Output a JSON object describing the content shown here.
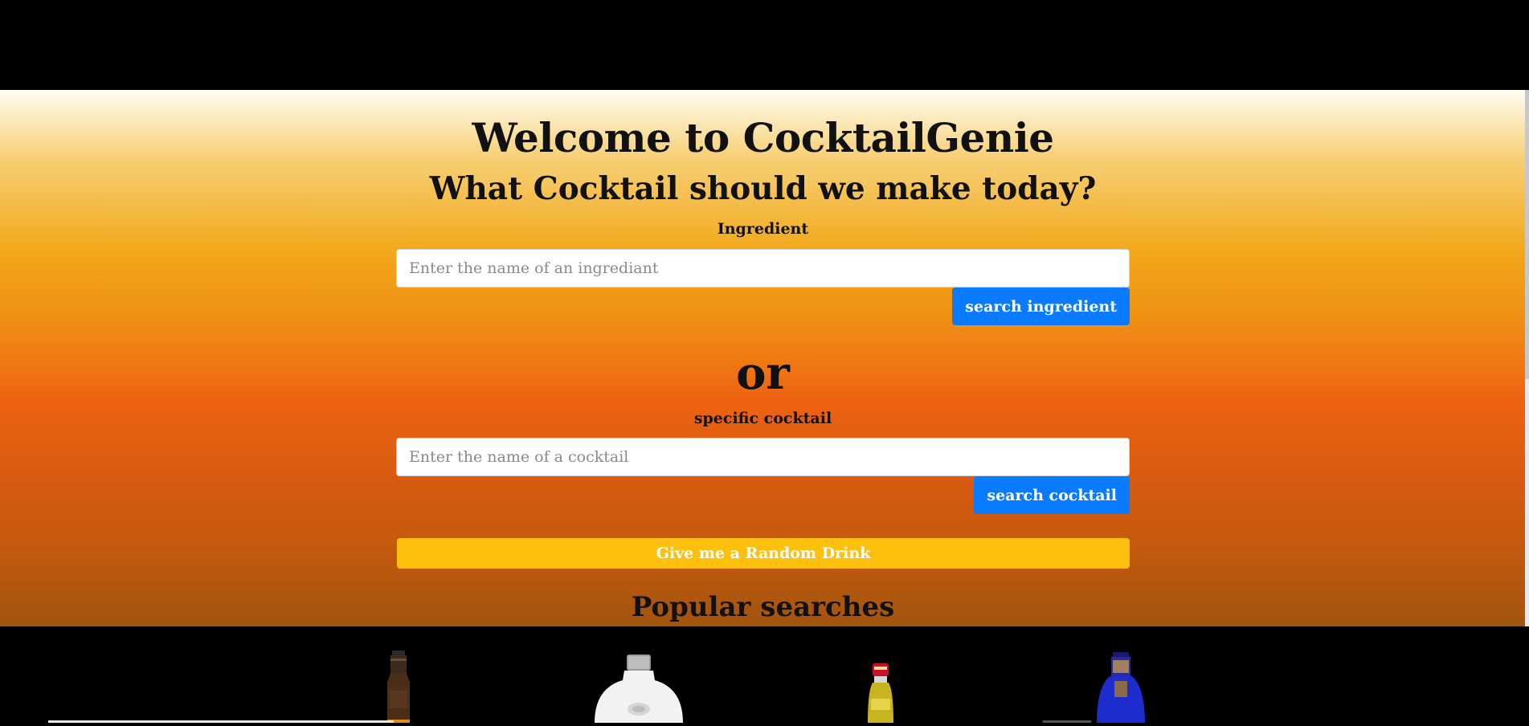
{
  "header": {
    "title": "Welcome to CocktailGenie",
    "subtitle": "What Cocktail should we make today?"
  },
  "ingredient_search": {
    "label": "Ingredient",
    "placeholder": "Enter the name of an ingrediant",
    "value": "",
    "button_label": "search ingredient"
  },
  "divider_text": "or",
  "cocktail_search": {
    "label": "specific cocktail",
    "placeholder": "Enter the name of a cocktail",
    "value": "",
    "button_label": "search cocktail"
  },
  "random_button_label": "Give me a Random Drink",
  "popular": {
    "heading": "Popular searches",
    "items": [
      {
        "icon": "whiskey-bottle-icon"
      },
      {
        "icon": "vodka-bottle-icon"
      },
      {
        "icon": "liqueur-bottle-icon"
      },
      {
        "icon": "gin-bottle-icon"
      }
    ]
  },
  "colors": {
    "primary_button": "#0a7bff",
    "random_button": "#fdc00c",
    "background_top": "#fffdf4",
    "background_mid": "#ee6212",
    "background_bottom": "#a2540e"
  }
}
